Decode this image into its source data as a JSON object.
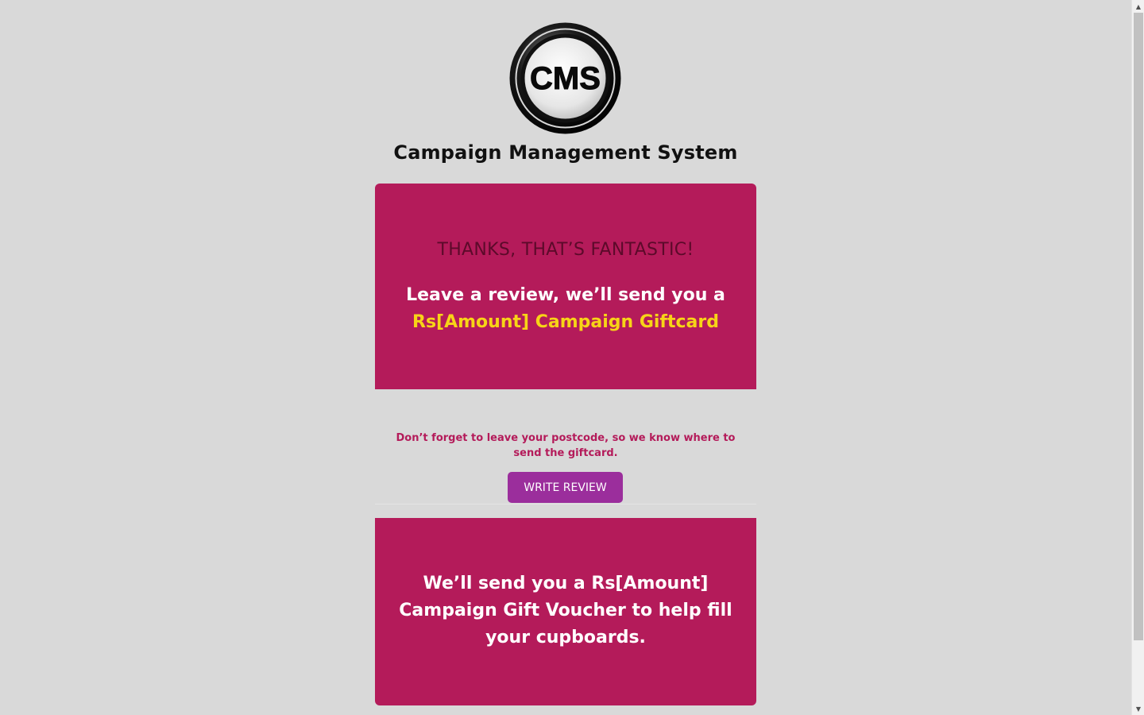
{
  "logo": {
    "text": "CMS"
  },
  "site_title": "Campaign Management System",
  "top_panel": {
    "heading": "THANKS, THAT’S FANTASTIC!",
    "line1": "Leave a review, we’ll send you a",
    "gift_text": "Rs[Amount] Campaign Giftcard"
  },
  "reminder": "Don’t forget to leave your postcode, so we know where to send the giftcard.",
  "write_review_label": "WRITE REVIEW",
  "bottom_panel": {
    "text": "We’ll send you a Rs[Amount] Campaign Gift Voucher to help fill your cupboards."
  },
  "colors": {
    "background": "#d9d9d9",
    "panel": "#b41b5a",
    "heading": "#5c0a2a",
    "gift": "#f7d417",
    "button": "#9b2e9c"
  },
  "icons": {
    "scroll_up": "▲",
    "scroll_down": "▼"
  }
}
